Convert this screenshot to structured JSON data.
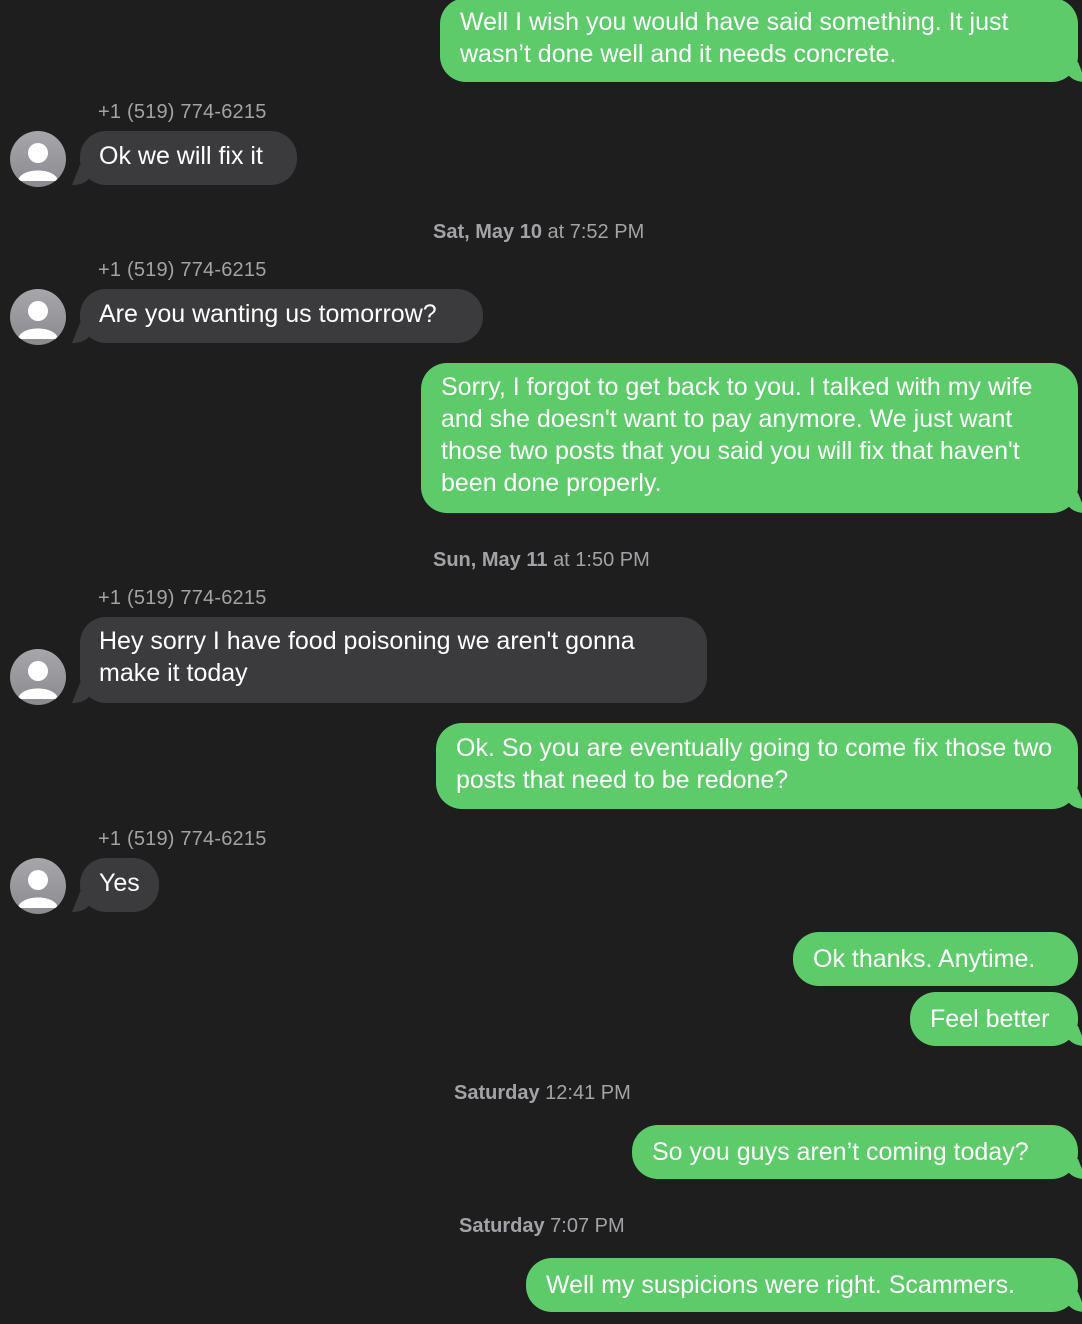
{
  "contact": {
    "number": "+1 (519) 774-6215"
  },
  "timestamps": {
    "t1_day": "Sat, May 10",
    "t1_time": "at 7:52 PM",
    "t2_day": "Sun, May 11",
    "t2_time": "at 1:50 PM",
    "t3_day": "Saturday",
    "t3_time": "12:41 PM",
    "t4_day": "Saturday",
    "t4_time": "7:07 PM"
  },
  "messages": [
    {
      "from": "me",
      "text": "Well I wish you would have said something. It just wasn’t done well and it needs concrete."
    },
    {
      "from": "them",
      "text": "Ok we will fix it"
    },
    {
      "from": "them",
      "text": "Are you wanting us tomorrow?"
    },
    {
      "from": "me",
      "text": "Sorry, I forgot to get back to you. I talked with my wife and she doesn't want to pay anymore. We just want those two posts that you said you will fix that haven't been done properly."
    },
    {
      "from": "them",
      "text": "Hey sorry I have food poisoning we aren't gonna make it today"
    },
    {
      "from": "me",
      "text": "Ok. So you are eventually going to come fix those two posts that need to be redone?"
    },
    {
      "from": "them",
      "text": "Yes"
    },
    {
      "from": "me",
      "text": "Ok thanks. Anytime."
    },
    {
      "from": "me",
      "text": "Feel better"
    },
    {
      "from": "me",
      "text": "So you guys aren’t coming today?"
    },
    {
      "from": "me",
      "text": "Well my suspicions were right. Scammers."
    }
  ],
  "colors": {
    "background": "#1e1e1e",
    "outgoing_bubble": "#5ecb6a",
    "incoming_bubble": "#3b3b3d",
    "meta_text": "#a3a3a7"
  },
  "icons": {
    "avatar": "person-silhouette-icon"
  }
}
